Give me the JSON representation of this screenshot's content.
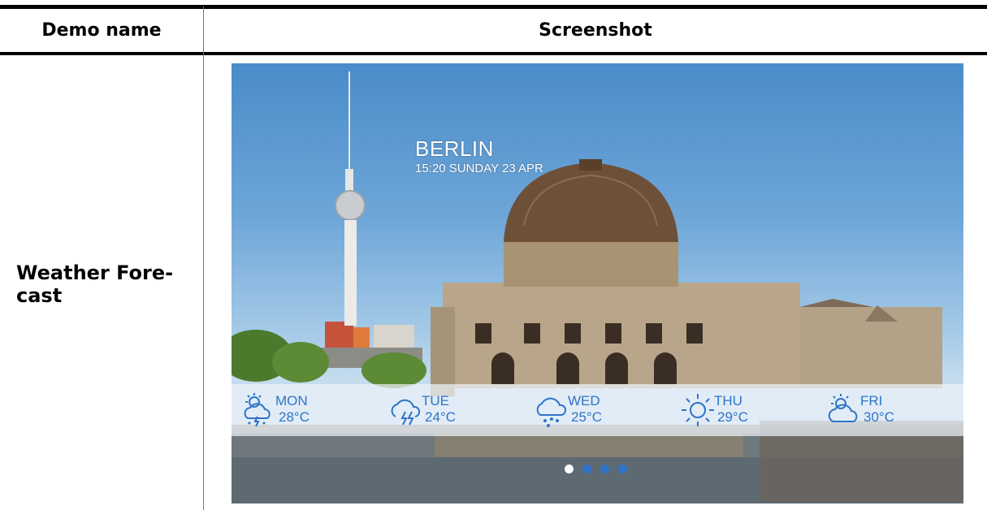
{
  "table": {
    "header": {
      "col1": "Demo name",
      "col2": "Screenshot"
    },
    "rows": [
      {
        "name": "Weather Fore-\ncast"
      }
    ]
  },
  "screenshot": {
    "city": "BERLIN",
    "datetime": "15:20 SUNDAY 23 APR",
    "forecast": [
      {
        "day": "MON",
        "temp": "28°C",
        "icon": "sun-cloud-storm-icon"
      },
      {
        "day": "TUE",
        "temp": "24°C",
        "icon": "cloud-lightning-icon"
      },
      {
        "day": "WED",
        "temp": "25°C",
        "icon": "cloud-rain-icon"
      },
      {
        "day": "THU",
        "temp": "29°C",
        "icon": "sun-icon"
      },
      {
        "day": "FRI",
        "temp": "30°C",
        "icon": "sun-cloud-icon"
      }
    ],
    "page_indicator": {
      "count": 4,
      "active": 1
    },
    "colors": {
      "accent": "#2f74c8",
      "text": "#ffffff"
    }
  }
}
